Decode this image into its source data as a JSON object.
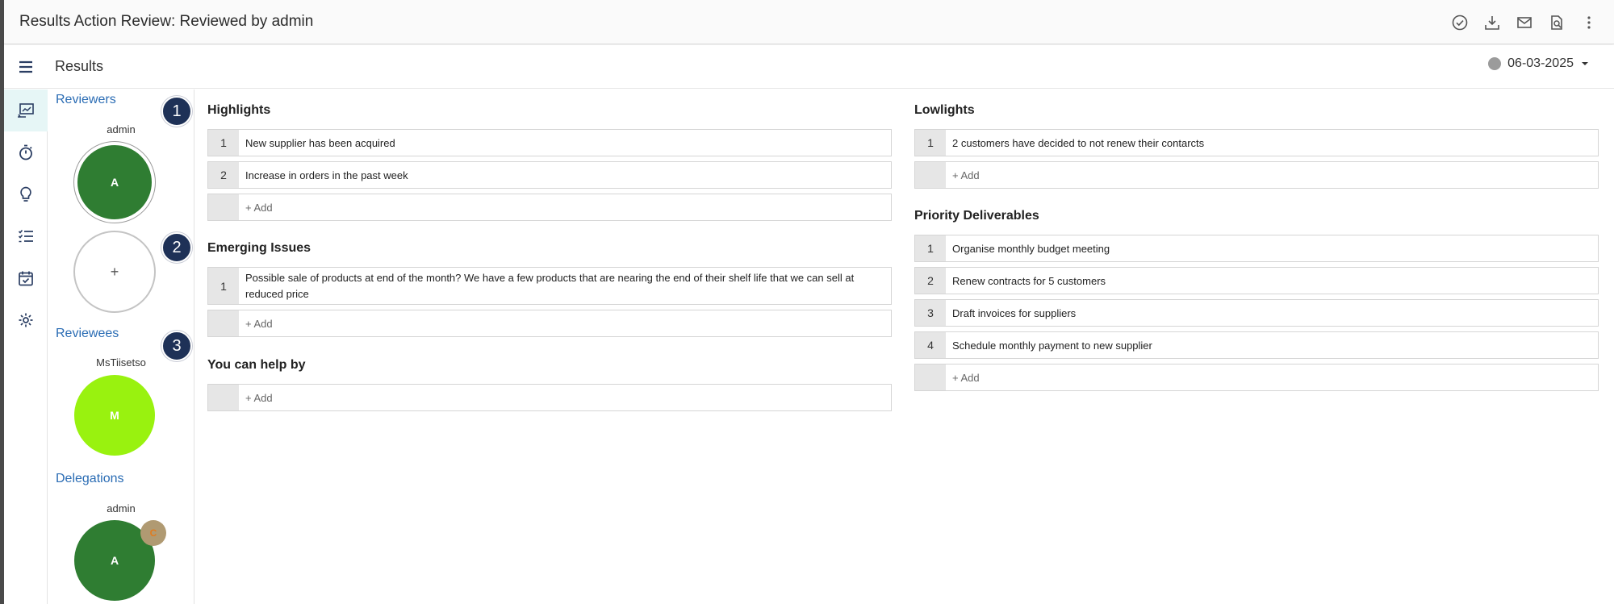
{
  "window": {
    "title": "Results Action Review: Reviewed by admin",
    "actions": [
      "check-circle-icon",
      "download-icon",
      "mail-icon",
      "document-search-icon",
      "more-vertical-icon"
    ]
  },
  "subheader": {
    "menu_icon": "hamburger-menu-icon",
    "page_title": "Results",
    "date": "06-03-2025",
    "date_status_color": "#9b9b9b"
  },
  "rail": {
    "items": [
      "results-chart-icon",
      "stopwatch-icon",
      "lightbulb-icon",
      "checklist-icon",
      "calendar-check-icon",
      "settings-gear-icon"
    ]
  },
  "people": {
    "reviewers_title": "Reviewers",
    "reviewer": {
      "name": "admin",
      "initial": "A",
      "color": "#2f7d32"
    },
    "add_reviewer": "+",
    "reviewees_title": "Reviewees",
    "reviewee": {
      "name": "MsTiisetso",
      "initial": "M",
      "color": "#99f20f"
    },
    "delegations_title": "Delegations",
    "delegation": {
      "name": "admin",
      "initial": "A",
      "color": "#2f7d32",
      "badge": "C",
      "badge_color": "#b09a72"
    }
  },
  "markers": [
    "1",
    "2",
    "3"
  ],
  "highlights": {
    "title": "Highlights",
    "items": [
      {
        "n": "1",
        "text": "New supplier has been acquired"
      },
      {
        "n": "2",
        "text": "Increase in orders in the past week"
      }
    ],
    "add": "+ Add"
  },
  "emerging": {
    "title": "Emerging Issues",
    "items": [
      {
        "n": "1",
        "text": "Possible sale of products at end of the month? We have a few products that are nearing the end of their shelf life that we can sell at reduced price"
      }
    ],
    "add": "+ Add"
  },
  "help": {
    "title": "You can help by",
    "add": "+ Add"
  },
  "lowlights": {
    "title": "Lowlights",
    "items": [
      {
        "n": "1",
        "text": "2 customers have decided to not renew their contarcts"
      }
    ],
    "add": "+ Add"
  },
  "priority": {
    "title": "Priority Deliverables",
    "items": [
      {
        "n": "1",
        "text": "Organise monthly budget meeting"
      },
      {
        "n": "2",
        "text": "Renew contracts for 5 customers"
      },
      {
        "n": "3",
        "text": "Draft invoices for suppliers"
      },
      {
        "n": "4",
        "text": "Schedule monthly payment to new supplier"
      }
    ],
    "add": "+ Add"
  }
}
